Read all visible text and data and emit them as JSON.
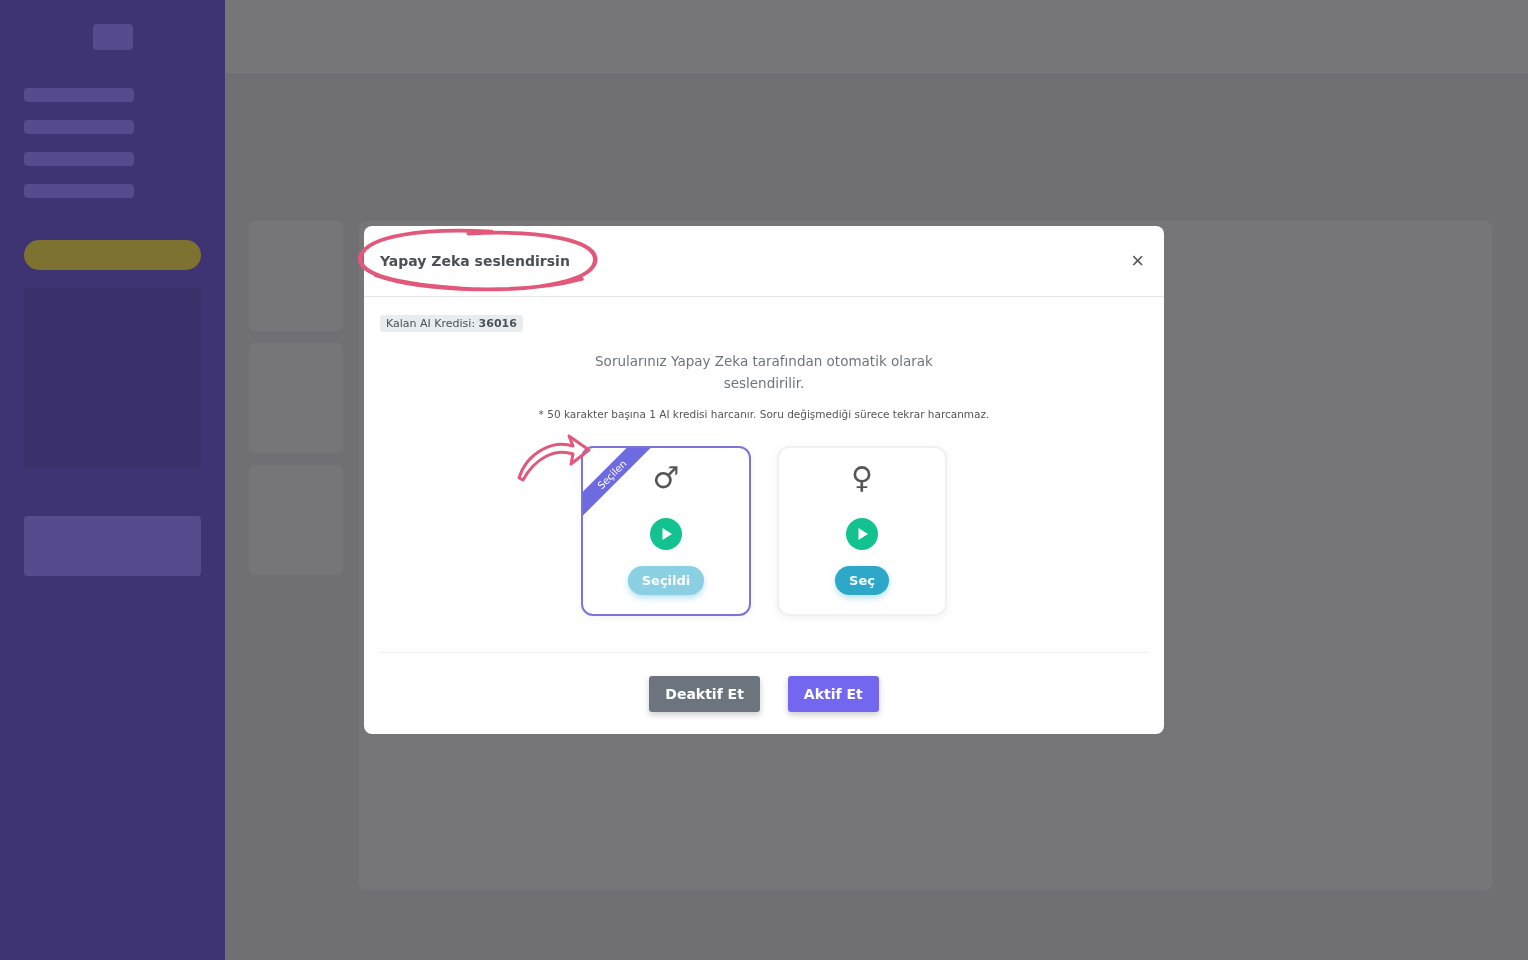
{
  "dialog": {
    "title": "Yapay Zeka seslendirsin",
    "close": "×",
    "credit": "Kalan AI Kredisi: **36016**",
    "description": "Sorularınız Yapay Zeka tarafından otomatik olarak seslendirilir.",
    "note": "* 50 karakter başına 1 AI kredisi harcanır. Soru değişmediği sürece tekrar harcanmaz.",
    "voices": [
      {
        "symbol": "♂",
        "selected": true,
        "ribbon": "Seçilen",
        "button": "Seçildi"
      },
      {
        "symbol": "♀",
        "selected": false,
        "button": "Seç"
      }
    ],
    "buttons": [
      {
        "label": "Deaktif Et",
        "kind": "secondary"
      },
      {
        "label": "Aktif Et",
        "kind": "primary"
      }
    ]
  },
  "annotations": {
    "title_circled": true,
    "arrow_to_selected": true
  }
}
